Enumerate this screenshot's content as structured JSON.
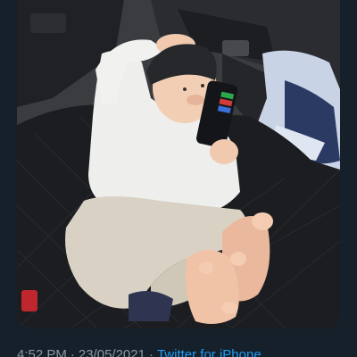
{
  "tweet": {
    "time": "4:52 PM",
    "date": "23/05/2021",
    "separator": "·",
    "source": "Twitter for iPhone"
  }
}
